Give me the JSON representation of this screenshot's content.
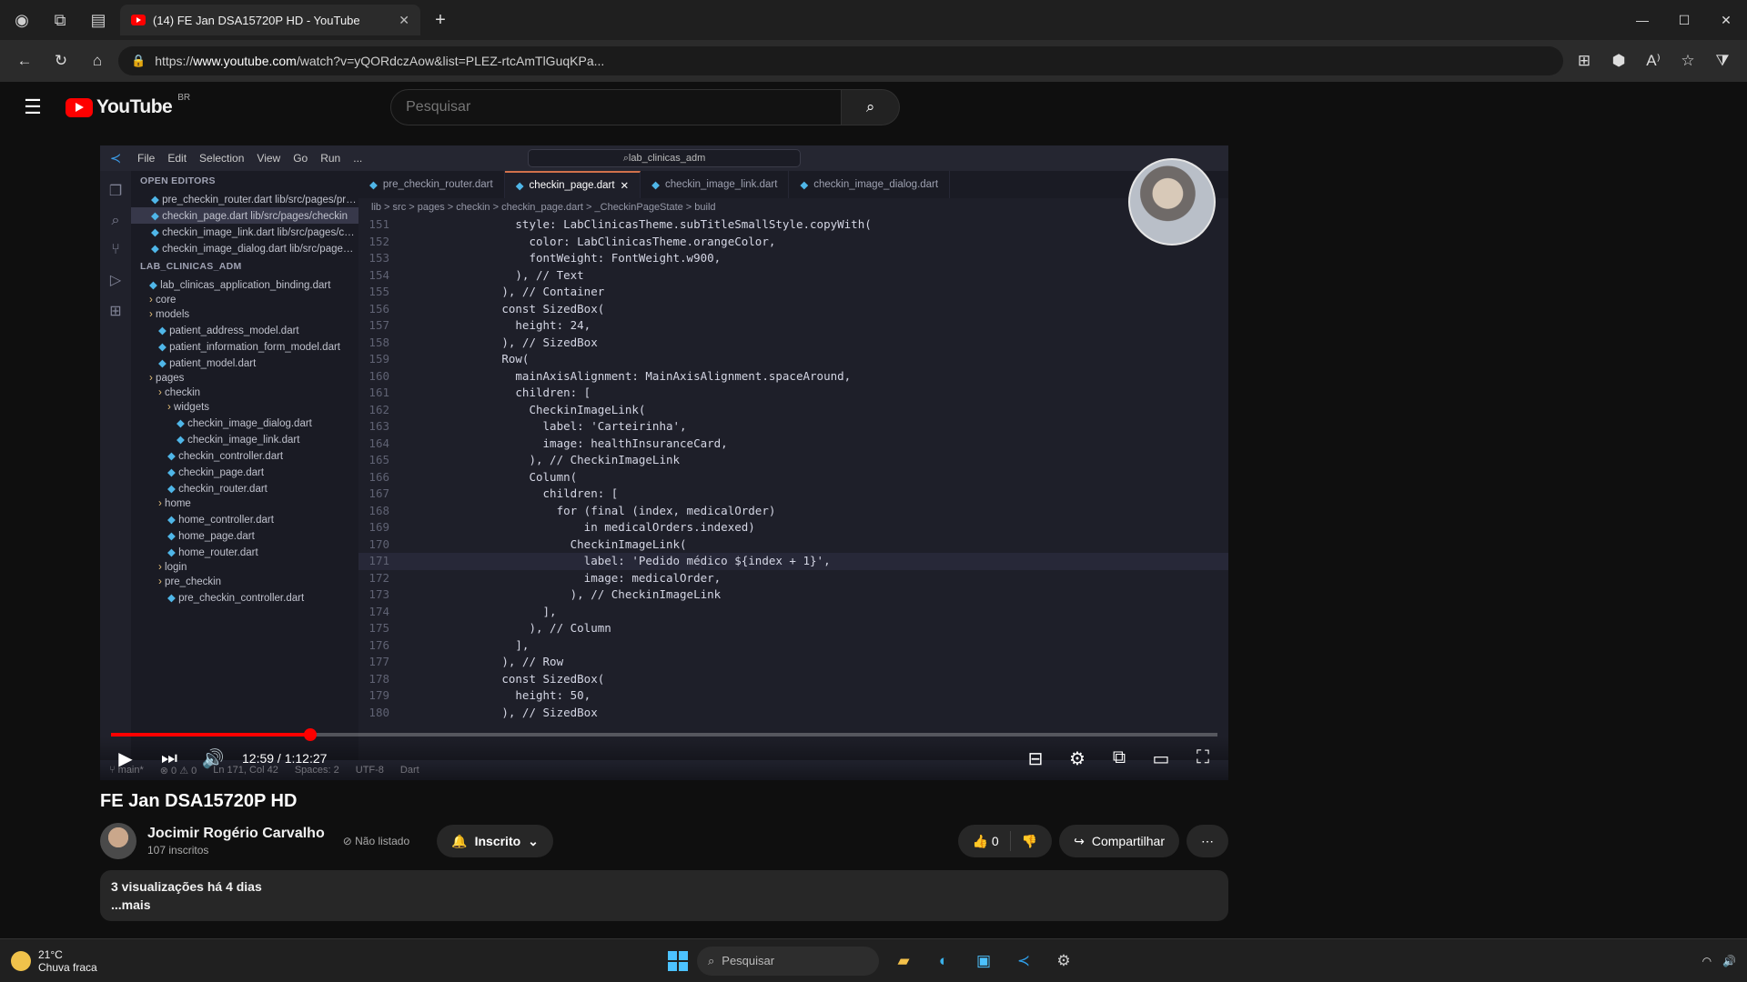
{
  "browser": {
    "tab_title": "(14) FE Jan DSA15720P HD - YouTube",
    "url_prefix": "https://",
    "url_host": "www.youtube.com",
    "url_path": "/watch?v=yQORdczAow&list=PLEZ-rtcAmTlGuqKPa..."
  },
  "youtube": {
    "logo_text": "YouTube",
    "country": "BR",
    "search_placeholder": "Pesquisar"
  },
  "vscode": {
    "menu": [
      "File",
      "Edit",
      "Selection",
      "View",
      "Go",
      "Run",
      "..."
    ],
    "title_search": "lab_clinicas_adm",
    "explorer_sections": {
      "open_editors": "OPEN EDITORS",
      "project": "LAB_CLINICAS_ADM"
    },
    "open_editors": [
      "pre_checkin_router.dart lib/src/pages/pre_checkin",
      "checkin_page.dart lib/src/pages/checkin",
      "checkin_image_link.dart lib/src/pages/checkin/...",
      "checkin_image_dialog.dart lib/src/pages/checkin/..."
    ],
    "tree": [
      "lab_clinicas_application_binding.dart",
      "core",
      "models",
      "patient_address_model.dart",
      "patient_information_form_model.dart",
      "patient_model.dart",
      "pages",
      "checkin",
      "widgets",
      "checkin_image_dialog.dart",
      "checkin_image_link.dart",
      "checkin_controller.dart",
      "checkin_page.dart",
      "checkin_router.dart",
      "home",
      "home_controller.dart",
      "home_page.dart",
      "home_router.dart",
      "login",
      "pre_checkin",
      "pre_checkin_controller.dart"
    ],
    "tabs": [
      "pre_checkin_router.dart",
      "checkin_page.dart",
      "checkin_image_link.dart",
      "checkin_image_dialog.dart"
    ],
    "breadcrumb": "lib > src > pages > checkin > checkin_page.dart > _CheckinPageState > build",
    "code_lines": [
      {
        "n": "151",
        "t": "                style: LabClinicasTheme.subTitleSmallStyle.copyWith("
      },
      {
        "n": "152",
        "t": "                  color: LabClinicasTheme.orangeColor,"
      },
      {
        "n": "153",
        "t": "                  fontWeight: FontWeight.w900,"
      },
      {
        "n": "154",
        "t": "                ), // Text"
      },
      {
        "n": "155",
        "t": "              ), // Container"
      },
      {
        "n": "156",
        "t": "              const SizedBox("
      },
      {
        "n": "157",
        "t": "                height: 24,"
      },
      {
        "n": "158",
        "t": "              ), // SizedBox"
      },
      {
        "n": "159",
        "t": "              Row("
      },
      {
        "n": "160",
        "t": "                mainAxisAlignment: MainAxisAlignment.spaceAround,"
      },
      {
        "n": "161",
        "t": "                children: ["
      },
      {
        "n": "162",
        "t": "                  CheckinImageLink("
      },
      {
        "n": "163",
        "t": "                    label: 'Carteirinha',"
      },
      {
        "n": "164",
        "t": "                    image: healthInsuranceCard,"
      },
      {
        "n": "165",
        "t": "                  ), // CheckinImageLink"
      },
      {
        "n": "166",
        "t": "                  Column("
      },
      {
        "n": "167",
        "t": "                    children: ["
      },
      {
        "n": "168",
        "t": "                      for (final (index, medicalOrder)"
      },
      {
        "n": "169",
        "t": "                          in medicalOrders.indexed)"
      },
      {
        "n": "170",
        "t": "                        CheckinImageLink("
      },
      {
        "n": "171",
        "t": "                          label: 'Pedido médico ${index + 1}',"
      },
      {
        "n": "172",
        "t": "                          image: medicalOrder,"
      },
      {
        "n": "173",
        "t": "                        ), // CheckinImageLink"
      },
      {
        "n": "174",
        "t": "                    ],"
      },
      {
        "n": "175",
        "t": "                  ), // Column"
      },
      {
        "n": "176",
        "t": "                ],"
      },
      {
        "n": "177",
        "t": "              ), // Row"
      },
      {
        "n": "178",
        "t": "              const SizedBox("
      },
      {
        "n": "179",
        "t": "                height: 50,"
      },
      {
        "n": "180",
        "t": "              ), // SizedBox"
      }
    ],
    "current_line": "171",
    "status": [
      "⑂ main*",
      "⊗ 0  ⚠ 0",
      "Ln 171, Col 42",
      "Spaces: 2",
      "UTF-8",
      "Dart"
    ]
  },
  "player": {
    "time": "12:59 / 1:12:27",
    "progress_fraction": 0.18
  },
  "video": {
    "title": "FE Jan DSA15720P HD",
    "visibility": "Não listado",
    "channel_name": "Jocimir Rogério Carvalho",
    "subscribers": "107 inscritos",
    "subscribed_label": "Inscrito",
    "like_count": "0",
    "share_label": "Compartilhar",
    "stats": "3 visualizações  há 4 dias",
    "more": "...mais"
  },
  "taskbar": {
    "temperature": "21°C",
    "weather": "Chuva fraca",
    "search_label": "Pesquisar"
  },
  "colors": {
    "accent": "#ff0000",
    "vscode_tab_active": "#d1714b"
  }
}
